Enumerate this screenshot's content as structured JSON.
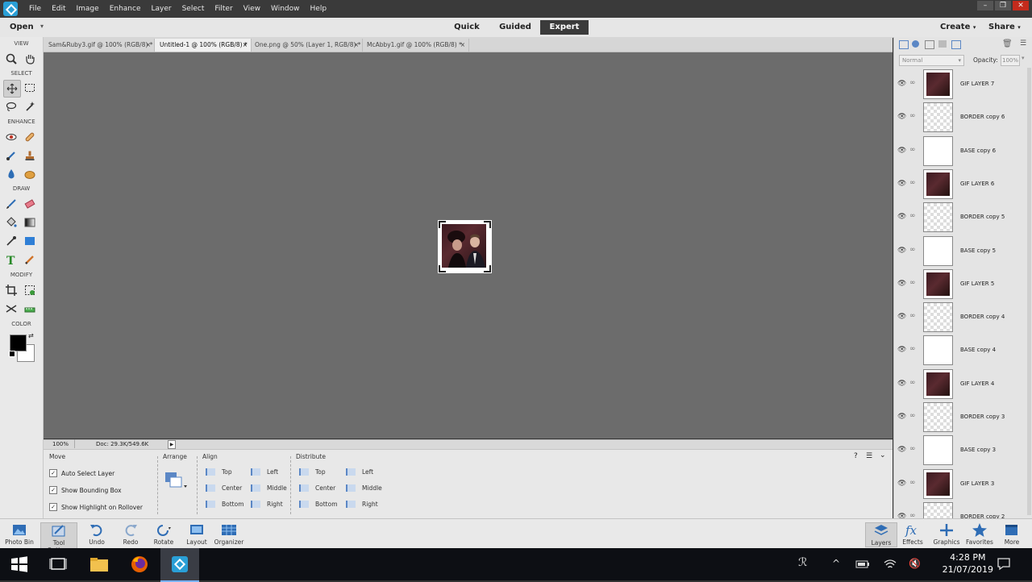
{
  "menu": [
    "File",
    "Edit",
    "Image",
    "Enhance",
    "Layer",
    "Select",
    "Filter",
    "View",
    "Window",
    "Help"
  ],
  "modebar": {
    "open": "Open",
    "tabs": [
      "Quick",
      "Guided",
      "Expert"
    ],
    "create": "Create",
    "share": "Share"
  },
  "toolbox": {
    "sections": [
      "VIEW",
      "SELECT",
      "ENHANCE",
      "DRAW",
      "MODIFY",
      "COLOR"
    ]
  },
  "doc_tabs": [
    {
      "label": "Sam&Ruby3.gif @ 100% (RGB/8) *",
      "active": false
    },
    {
      "label": "Untitled-1 @ 100% (RGB/8) *",
      "active": true
    },
    {
      "label": "One.png @ 50% (Layer 1, RGB/8) *",
      "active": false
    },
    {
      "label": "McAbby1.gif @ 100% (RGB/8) *",
      "active": false
    }
  ],
  "status": {
    "zoom": "100%",
    "doc": "Doc: 29.3K/549.6K"
  },
  "options": {
    "move": {
      "title": "Move",
      "checks": [
        "Auto Select Layer",
        "Show Bounding Box",
        "Show Highlight on Rollover"
      ]
    },
    "arrange": {
      "title": "Arrange"
    },
    "align": {
      "title": "Align",
      "items": [
        "Top",
        "Center",
        "Bottom",
        "Left",
        "Middle",
        "Right"
      ]
    },
    "distribute": {
      "title": "Distribute",
      "items": [
        "Top",
        "Center",
        "Bottom",
        "Left",
        "Middle",
        "Right"
      ]
    }
  },
  "panel": {
    "blend": "Normal",
    "opacity_label": "Opacity:",
    "opacity_value": "100%"
  },
  "layers": [
    {
      "name": "GIF LAYER 7",
      "kind": "gif"
    },
    {
      "name": "BORDER copy 6",
      "kind": "border"
    },
    {
      "name": "BASE copy 6",
      "kind": "base"
    },
    {
      "name": "GIF LAYER 6",
      "kind": "gif"
    },
    {
      "name": "BORDER copy 5",
      "kind": "border"
    },
    {
      "name": "BASE copy 5",
      "kind": "base"
    },
    {
      "name": "GIF LAYER 5",
      "kind": "gif"
    },
    {
      "name": "BORDER copy 4",
      "kind": "border"
    },
    {
      "name": "BASE copy 4",
      "kind": "base"
    },
    {
      "name": "GIF LAYER 4",
      "kind": "gif"
    },
    {
      "name": "BORDER copy 3",
      "kind": "border"
    },
    {
      "name": "BASE copy 3",
      "kind": "base"
    },
    {
      "name": "GIF LAYER 3",
      "kind": "gif"
    },
    {
      "name": "BORDER copy 2",
      "kind": "border"
    }
  ],
  "bottombar": {
    "left": [
      "Photo Bin",
      "Tool Options",
      "Undo",
      "Redo",
      "Rotate",
      "Layout",
      "Organizer"
    ],
    "right": [
      "Layers",
      "Effects",
      "Graphics",
      "Favorites",
      "More"
    ]
  },
  "taskbar": {
    "time": "4:28 PM",
    "date": "21/07/2019"
  },
  "colors": {
    "accent": "#2a9fd6",
    "canvas": "#6c6c6c",
    "expert_tab": "#3b3b3b"
  }
}
